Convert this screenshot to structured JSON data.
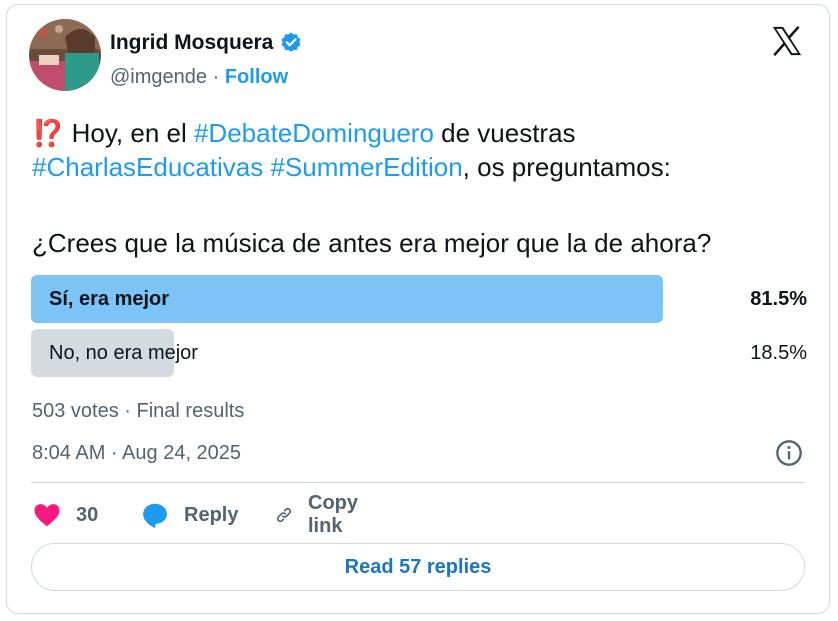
{
  "author": {
    "name": "Ingrid Mosquera",
    "handle": "@imgende",
    "separator": "·",
    "follow_label": "Follow"
  },
  "tweet": {
    "emoji": "⁉️",
    "line1_pre": "Hoy, en el ",
    "hashtag1": "#DebateDominguero",
    "line1_post": " de vuestras",
    "hashtag2": "#CharlasEducativas",
    "hashtag3": "#SummerEdition",
    "line2_post": ", os preguntamos:",
    "question": "¿Crees que la música de antes era mejor que la de ahora?"
  },
  "poll": {
    "options": [
      {
        "label": "Sí, era mejor",
        "percent_label": "81.5%",
        "percent": 81.5
      },
      {
        "label": "No, no era mejor",
        "percent_label": "18.5%",
        "percent": 18.5
      }
    ],
    "summary": "503 votes · Final results"
  },
  "timestamp": "8:04 AM · Aug 24, 2025",
  "actions": {
    "likes": "30",
    "reply_label": "Reply",
    "copy_label": "Copy link"
  },
  "read_replies_label": "Read 57 replies",
  "colors": {
    "accent": "#1d9bf0",
    "heart": "#f91880",
    "winning_bar": "#7cc3f6",
    "losing_bar": "#d3dae0"
  }
}
